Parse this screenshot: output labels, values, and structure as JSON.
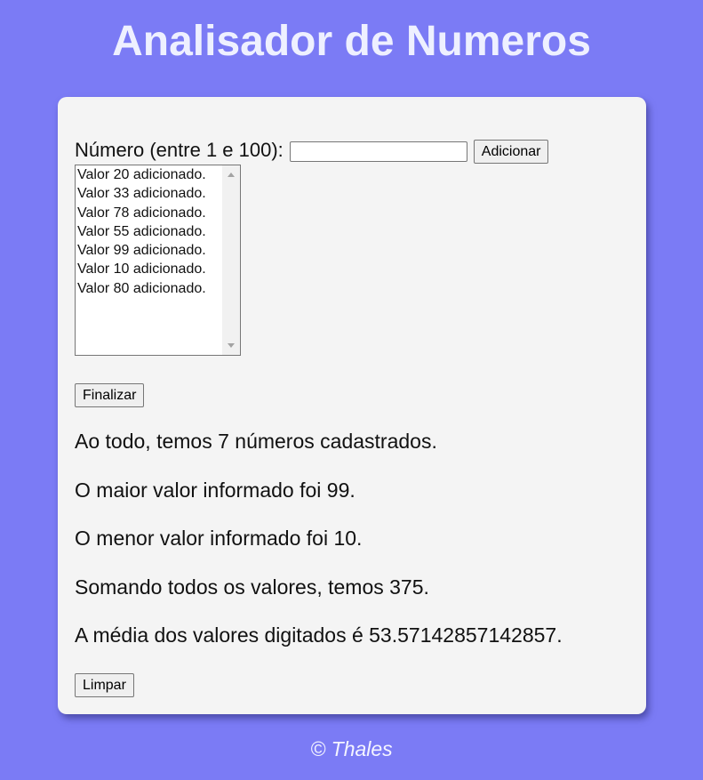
{
  "header": {
    "title": "Analisador de Numeros"
  },
  "form": {
    "label": "Número (entre 1 e 100):",
    "input_value": "",
    "input_placeholder": "",
    "add_button_label": "Adicionar"
  },
  "list": {
    "items": [
      "Valor 20 adicionado.",
      "Valor 33 adicionado.",
      "Valor 78 adicionado.",
      "Valor 55 adicionado.",
      "Valor 99 adicionado.",
      "Valor 10 adicionado.",
      "Valor 80 adicionado."
    ]
  },
  "finish_button_label": "Finalizar",
  "results": [
    "Ao todo, temos 7 números cadastrados.",
    "O maior valor informado foi 99.",
    "O menor valor informado foi 10.",
    "Somando todos os valores, temos 375.",
    "A média dos valores digitados é 53.57142857142857."
  ],
  "clear_button_label": "Limpar",
  "footer": {
    "text": "© Thales"
  },
  "colors": {
    "background": "#7b7bf5",
    "card": "#f4f4f4",
    "title": "#eef0ff"
  }
}
